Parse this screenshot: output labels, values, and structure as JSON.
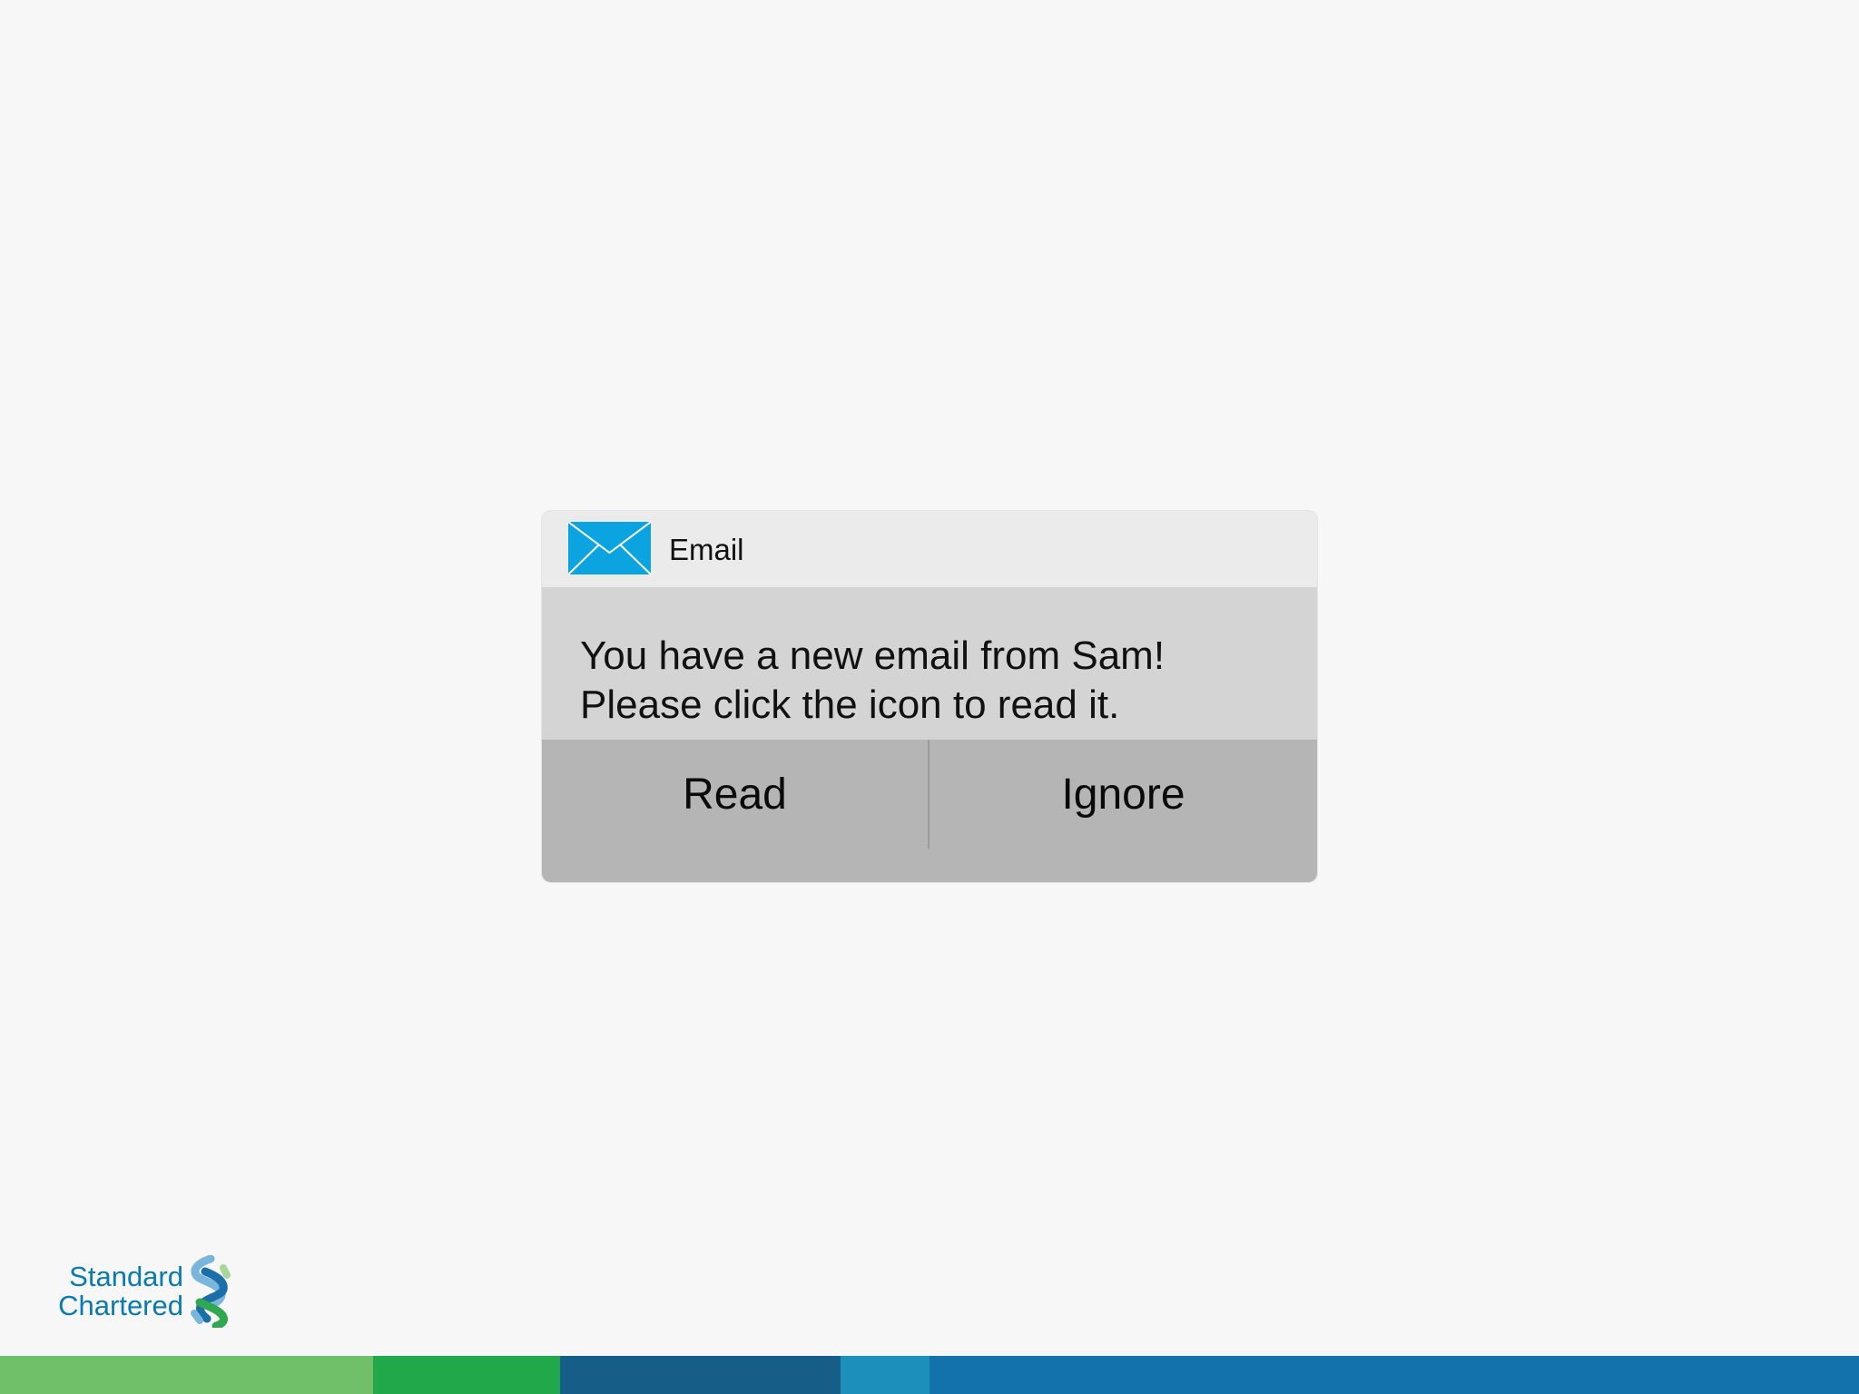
{
  "notification": {
    "app_name": "Email",
    "icon": "envelope-icon",
    "message_line1": "You have a new email from Sam!",
    "message_line2": "Please click the icon to read it.",
    "actions": {
      "read_label": "Read",
      "ignore_label": "Ignore"
    }
  },
  "brand": {
    "line1": "Standard",
    "line2": "Chartered",
    "icon": "standard-chartered-logo-icon"
  },
  "colors": {
    "background": "#f7f7f7",
    "envelope": "#0ba4e0",
    "brand_text": "#0a7ab2",
    "footer_segments": [
      "#70bf69",
      "#21a84a",
      "#165d88",
      "#1c8fbb",
      "#1372ab"
    ]
  }
}
